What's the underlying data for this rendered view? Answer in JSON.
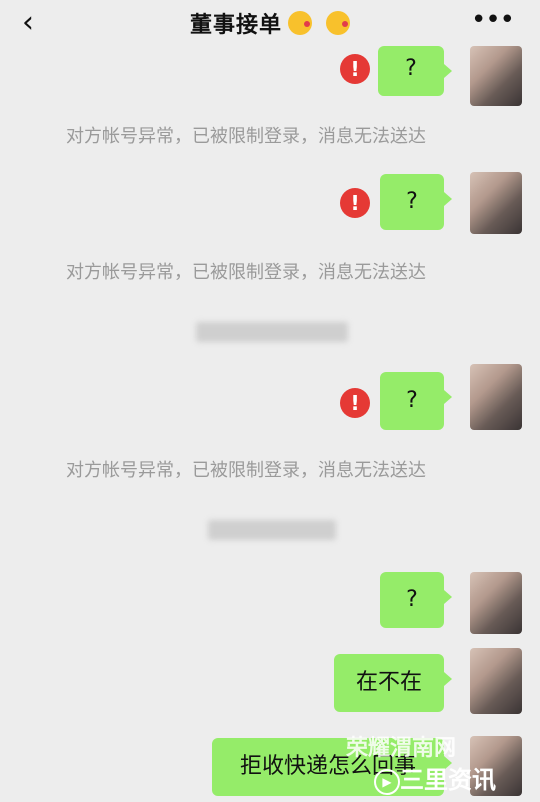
{
  "header": {
    "back_icon": "chevron-left-icon",
    "title": "董事接单",
    "more_icon": "more-icon"
  },
  "messages": [
    {
      "text": "?",
      "status": "failed"
    },
    {
      "text": "对方帐号异常，已被限制登录，消息无法送达"
    },
    {
      "text": "?",
      "status": "failed"
    },
    {
      "text": "对方帐号异常，已被限制登录，消息无法送达"
    },
    {
      "text": "?",
      "status": "failed"
    },
    {
      "text": "对方帐号异常，已被限制登录，消息无法送达"
    },
    {
      "text": "?"
    },
    {
      "text": "在不在"
    },
    {
      "text": "拒收快递怎么回事"
    }
  ],
  "watermark": {
    "main": "荣耀渭南网",
    "secondary": "三里资讯"
  },
  "colors": {
    "background": "#ededed",
    "bubble": "#95ec69",
    "error": "#e53935",
    "system_text": "#9a9a9a"
  }
}
